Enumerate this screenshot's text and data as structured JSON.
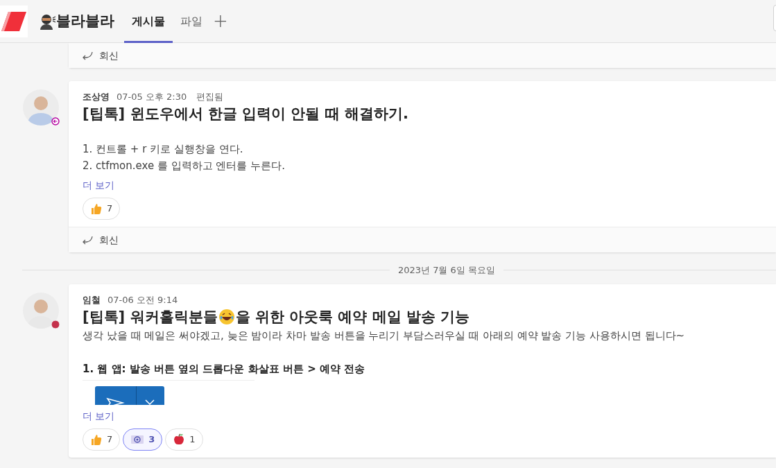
{
  "header": {
    "channel_name": "블라블라",
    "tabs": [
      {
        "label": "게시물",
        "selected": true
      },
      {
        "label": "파일",
        "selected": false
      }
    ],
    "add_tab": "+"
  },
  "top_reply": "회신",
  "feed": [
    {
      "kind": "post",
      "author": "조상영",
      "time": "07-05 오후 2:30",
      "edited": "편집됨",
      "status_icon": {
        "kind": "away"
      },
      "title": [
        "[팁톡] 윈도우에서 한글 입력이 안될 때 해결하기."
      ],
      "body": [
        {
          "kind": "gap"
        },
        {
          "kind": "text",
          "text": "1. 컨트롤 + r 키로 실행창을 연다."
        },
        {
          "kind": "text",
          "text": "2. ctfmon.exe 를 입력하고 엔터를 누른다."
        }
      ],
      "see_more": "더 보기",
      "reactions": [
        {
          "kind": "like",
          "count": "7",
          "selected": false
        }
      ],
      "reply": "회신"
    },
    {
      "kind": "divider",
      "text": "2023년 7월 6일 목요일"
    },
    {
      "kind": "post",
      "author": "임철",
      "time": "07-06 오전 9:14",
      "status_icon": {
        "kind": "busy"
      },
      "title": [
        "[팁톡] 워커홀릭분들",
        "을 위한 아웃룩 예약 메일 발송 기능"
      ],
      "body": [
        {
          "kind": "text",
          "text": "생각 났을 때 메일은 써야겠고, 늦은 밤이라 차마 발송 버튼을 누리기 부담스러우실 때 아래의 예약 발송 기능 사용하시면 됩니다~"
        },
        {
          "kind": "gap"
        },
        {
          "kind": "bold",
          "text": "1. 웹 앱: 발송 버튼 옆의 드롭다운 화살표 버튼 > 예약 전송"
        },
        {
          "kind": "image"
        }
      ],
      "see_more": "더 보기",
      "reactions": [
        {
          "kind": "like",
          "count": "7",
          "selected": false
        },
        {
          "kind": "mail",
          "count": "3",
          "selected": true
        },
        {
          "kind": "apple",
          "count": "1",
          "selected": false
        }
      ]
    }
  ]
}
